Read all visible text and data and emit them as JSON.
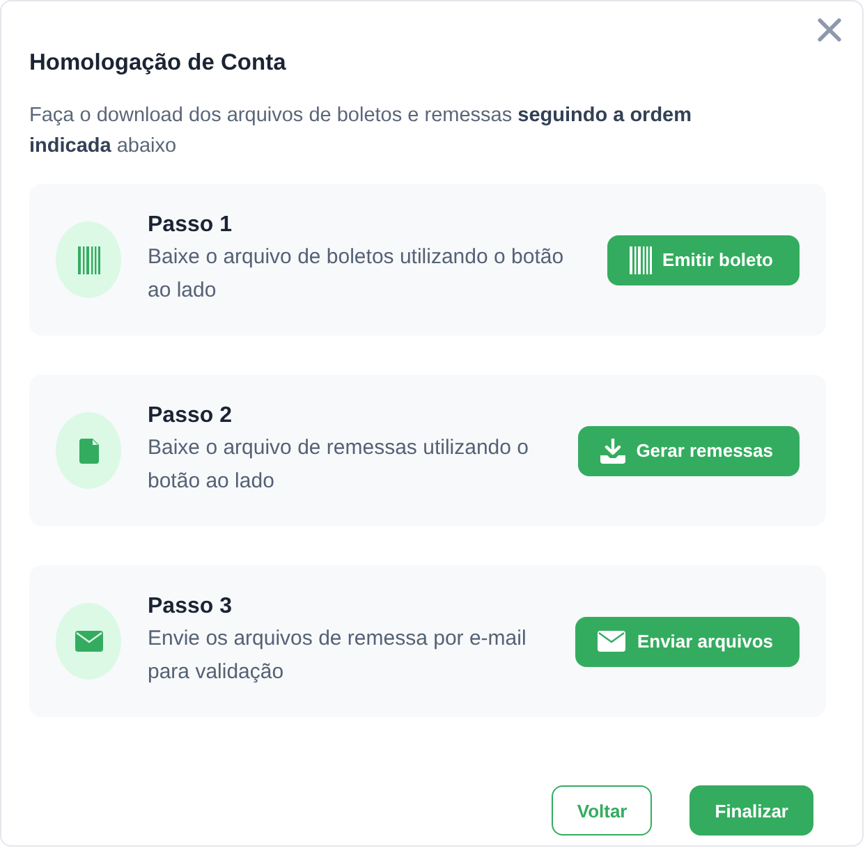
{
  "dialog": {
    "title": "Homologação de Conta",
    "intro": "Faça o download dos arquivos de boletos e remessas **seguindo a ordem indicada** abaixo"
  },
  "steps": [
    {
      "kind": "barcode",
      "title": "Passo 1",
      "text": "Baixe o arquivo de boletos utilizando o botão ao lado",
      "button": {
        "kind": "barcode",
        "label": "Emitir boleto"
      }
    },
    {
      "kind": "file",
      "title": "Passo 2",
      "text": "Baixe o arquivo de remessas utilizando o botão ao lado",
      "button": {
        "kind": "download",
        "label": "Gerar remessas"
      }
    },
    {
      "kind": "mail",
      "title": "Passo 3",
      "text": "Envie os arquivos de remessa por e-mail para validação",
      "button": {
        "kind": "mail",
        "label": "Enviar arquivos"
      }
    }
  ],
  "footer_buttons": [
    {
      "kind": "outline",
      "label": "Voltar"
    },
    {
      "kind": "filled",
      "label": "Finalizar"
    }
  ]
}
